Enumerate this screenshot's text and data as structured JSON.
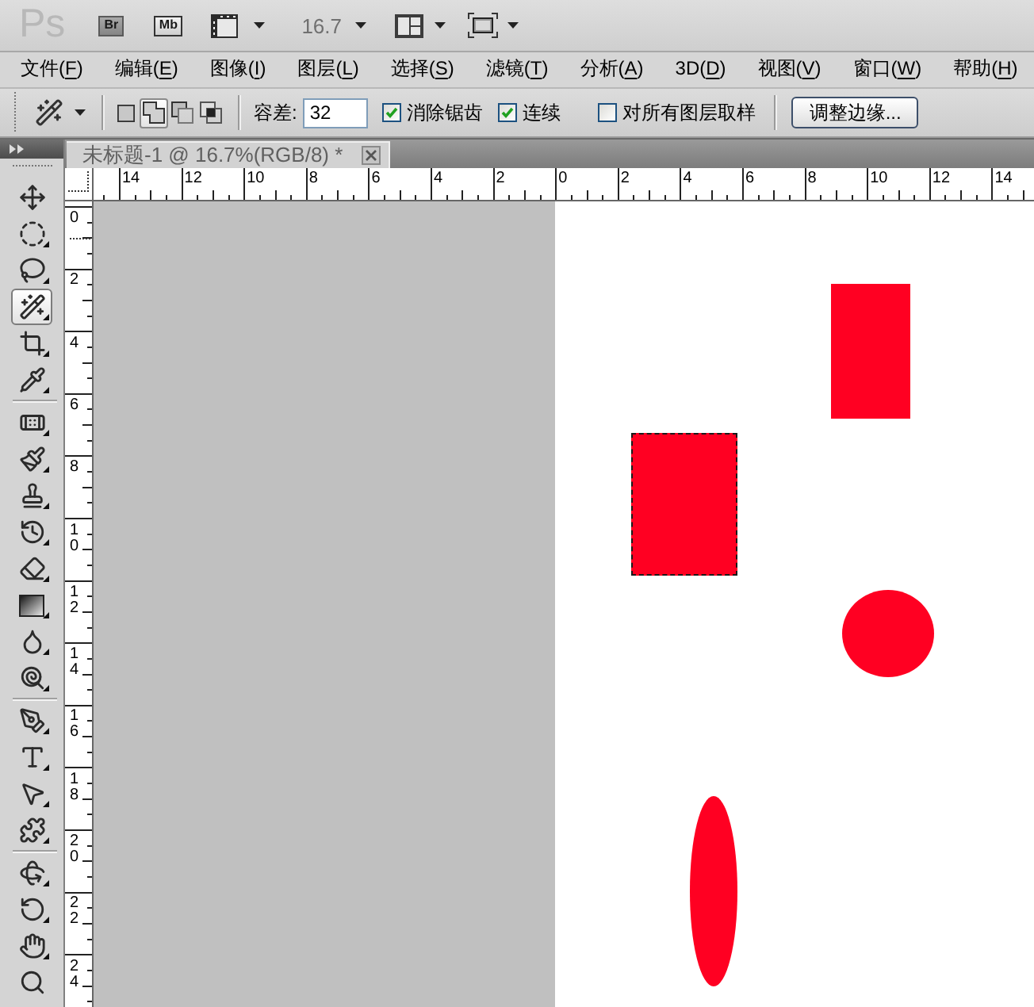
{
  "app_bar": {
    "logo": "Ps",
    "bridge_button": "Br",
    "mini_bridge_button": "Mb",
    "zoom_level": "16.7"
  },
  "menu": [
    {
      "before": "文件(",
      "key": "F",
      "after": ")"
    },
    {
      "before": "编辑(",
      "key": "E",
      "after": ")"
    },
    {
      "before": "图像(",
      "key": "I",
      "after": ")"
    },
    {
      "before": "图层(",
      "key": "L",
      "after": ")"
    },
    {
      "before": "选择(",
      "key": "S",
      "after": ")"
    },
    {
      "before": "滤镜(",
      "key": "T",
      "after": ")"
    },
    {
      "before": "分析(",
      "key": "A",
      "after": ")"
    },
    {
      "before": "3D(",
      "key": "D",
      "after": ")"
    },
    {
      "before": "视图(",
      "key": "V",
      "after": ")"
    },
    {
      "before": "窗口(",
      "key": "W",
      "after": ")"
    },
    {
      "before": "帮助(",
      "key": "H",
      "after": ")"
    }
  ],
  "options_bar": {
    "selection_modes": [
      {
        "kind": "new",
        "selected": false
      },
      {
        "kind": "add",
        "selected": true
      },
      {
        "kind": "subtract",
        "selected": false
      },
      {
        "kind": "intersect",
        "selected": false
      }
    ],
    "tolerance": {
      "label": "容差:",
      "value": "32"
    },
    "checkboxes": [
      {
        "label": "消除锯齿",
        "checked": true
      },
      {
        "label": "连续",
        "checked": true
      },
      {
        "label": "对所有图层取样",
        "checked": false
      }
    ],
    "refine_edge_button": "调整边缘..."
  },
  "tools": [
    {
      "kind": "move",
      "selected": false,
      "flyout": false
    },
    {
      "kind": "elliptical_marquee",
      "selected": false,
      "flyout": true
    },
    {
      "kind": "lasso",
      "selected": false,
      "flyout": true
    },
    {
      "kind": "magic_wand",
      "selected": true,
      "flyout": true
    },
    {
      "kind": "crop",
      "selected": false,
      "flyout": true
    },
    {
      "kind": "eyedropper",
      "selected": false,
      "flyout": true
    },
    {
      "kind": "separator"
    },
    {
      "kind": "healing_brush",
      "selected": false,
      "flyout": true
    },
    {
      "kind": "brush",
      "selected": false,
      "flyout": true
    },
    {
      "kind": "clone_stamp",
      "selected": false,
      "flyout": true
    },
    {
      "kind": "history_brush",
      "selected": false,
      "flyout": true
    },
    {
      "kind": "eraser",
      "selected": false,
      "flyout": true
    },
    {
      "kind": "gradient",
      "selected": false,
      "flyout": true
    },
    {
      "kind": "blur",
      "selected": false,
      "flyout": true
    },
    {
      "kind": "dodge",
      "selected": false,
      "flyout": true
    },
    {
      "kind": "separator"
    },
    {
      "kind": "pen",
      "selected": false,
      "flyout": true
    },
    {
      "kind": "type",
      "selected": false,
      "flyout": true
    },
    {
      "kind": "path_selection",
      "selected": false,
      "flyout": true
    },
    {
      "kind": "custom_shape",
      "selected": false,
      "flyout": true
    },
    {
      "kind": "separator"
    },
    {
      "kind": "rotate_3d",
      "selected": false,
      "flyout": true
    },
    {
      "kind": "roll_3d",
      "selected": false,
      "flyout": true
    },
    {
      "kind": "hand",
      "selected": false,
      "flyout": true
    },
    {
      "kind": "zoom",
      "selected": false,
      "flyout": false
    }
  ],
  "document_tab": {
    "title": "未标题-1 @ 16.7%(RGB/8) *",
    "selected": true
  },
  "rulers": {
    "horizontal": [
      "14",
      "12",
      "10",
      "8",
      "6",
      "4",
      "2",
      "0",
      "2",
      "4",
      "6",
      "8",
      "10",
      "12",
      "14"
    ],
    "vertical": [
      "0",
      "2",
      "4",
      "6",
      "8",
      "10",
      "12",
      "14",
      "16",
      "18",
      "20",
      "22",
      "24"
    ]
  },
  "canvas": {
    "shapes": [
      {
        "kind": "rectangle",
        "selected": false
      },
      {
        "kind": "rectangle",
        "selected": true
      },
      {
        "kind": "ellipse",
        "selected": false
      },
      {
        "kind": "ellipse",
        "selected": false
      }
    ]
  }
}
